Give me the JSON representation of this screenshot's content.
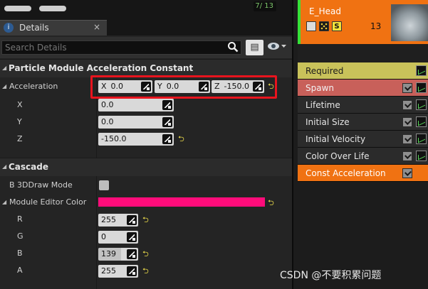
{
  "top_counter": "7/ 13",
  "details_tab": {
    "icon": "magnifier-info-icon",
    "label": "Details",
    "close": "×"
  },
  "search": {
    "placeholder": "Search Details",
    "icon": "magnifier-icon",
    "grid_icon": "grid-list-icon",
    "eye_icon": "eye-icon"
  },
  "section_accel": {
    "title": "Particle Module Acceleration Constant",
    "acceleration": {
      "label": "Acceleration",
      "x_tag": "X",
      "x_value": "0.0",
      "y_tag": "Y",
      "y_value": "0.0",
      "z_tag": "Z",
      "z_value": "-150.0"
    },
    "x": {
      "label": "X",
      "value": "0.0"
    },
    "y": {
      "label": "Y",
      "value": "0.0"
    },
    "z": {
      "label": "Z",
      "value": "-150.0"
    }
  },
  "section_cascade": {
    "title": "Cascade",
    "draw_mode": {
      "label": "B 3DDraw Mode",
      "checked": false
    },
    "module_editor_color": {
      "label": "Module Editor Color",
      "color": "#ff0c7a"
    },
    "r": {
      "label": "R",
      "value": "255"
    },
    "g": {
      "label": "G",
      "value": "0"
    },
    "b": {
      "label": "B",
      "value": "139"
    },
    "a": {
      "label": "A",
      "value": "255"
    }
  },
  "emitter": {
    "name": "E_Head",
    "count": "13",
    "icons": [
      "checkbox-icon",
      "dots-icon",
      "solo-icon"
    ],
    "solo_label": "S",
    "color": "#f07212"
  },
  "modules": [
    {
      "label": "Required",
      "bg": "#c9c25a",
      "text": "#1b1b1b",
      "check": false,
      "graph": true
    },
    {
      "label": "Spawn",
      "bg": "#c8605a",
      "text": "#f3f3f3",
      "check": true,
      "graph": true
    },
    {
      "label": "Lifetime",
      "bg": "#2b2b2b",
      "text": "#e6e6e6",
      "check": true,
      "graph": true
    },
    {
      "label": "Initial Size",
      "bg": "#2b2b2b",
      "text": "#e6e6e6",
      "check": true,
      "graph": true
    },
    {
      "label": "Initial Velocity",
      "bg": "#2b2b2b",
      "text": "#e6e6e6",
      "check": true,
      "graph": true
    },
    {
      "label": "Color Over Life",
      "bg": "#2b2b2b",
      "text": "#e6e6e6",
      "check": true,
      "graph": true
    },
    {
      "label": "Const Acceleration",
      "bg": "#f07212",
      "text": "#ffffff",
      "check": true,
      "graph": false
    }
  ],
  "watermark": "CSDN @不要积累问题",
  "reset_glyph": "⮌"
}
